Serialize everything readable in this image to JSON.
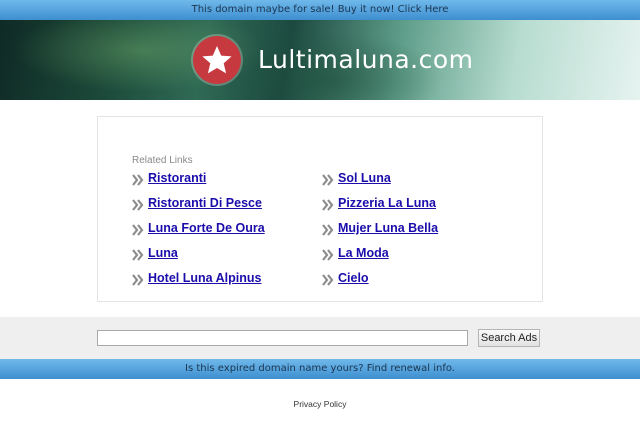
{
  "top_bar": {
    "text": "This domain maybe for sale! Buy it now! Click Here"
  },
  "banner": {
    "site_name": "Lultimaluna.com",
    "logo_icon": "star-icon",
    "logo_color": "#c63a3f"
  },
  "related": {
    "title": "Related Links",
    "left_links": [
      "Ristoranti",
      "Ristoranti Di Pesce",
      "Luna Forte De Oura",
      "Luna",
      "Hotel Luna Alpinus"
    ],
    "right_links": [
      "Sol Luna",
      "Pizzeria La Luna",
      "Mujer Luna Bella",
      "La Moda",
      "Cielo"
    ],
    "link_icon": "double-chevron-right-icon",
    "link_color": "#1a0dab"
  },
  "search": {
    "value": "",
    "button_label": "Search Ads"
  },
  "bottom_bar": {
    "text": "Is this expired domain name yours? Find renewal info."
  },
  "footer": {
    "privacy_label": "Privacy Policy"
  }
}
